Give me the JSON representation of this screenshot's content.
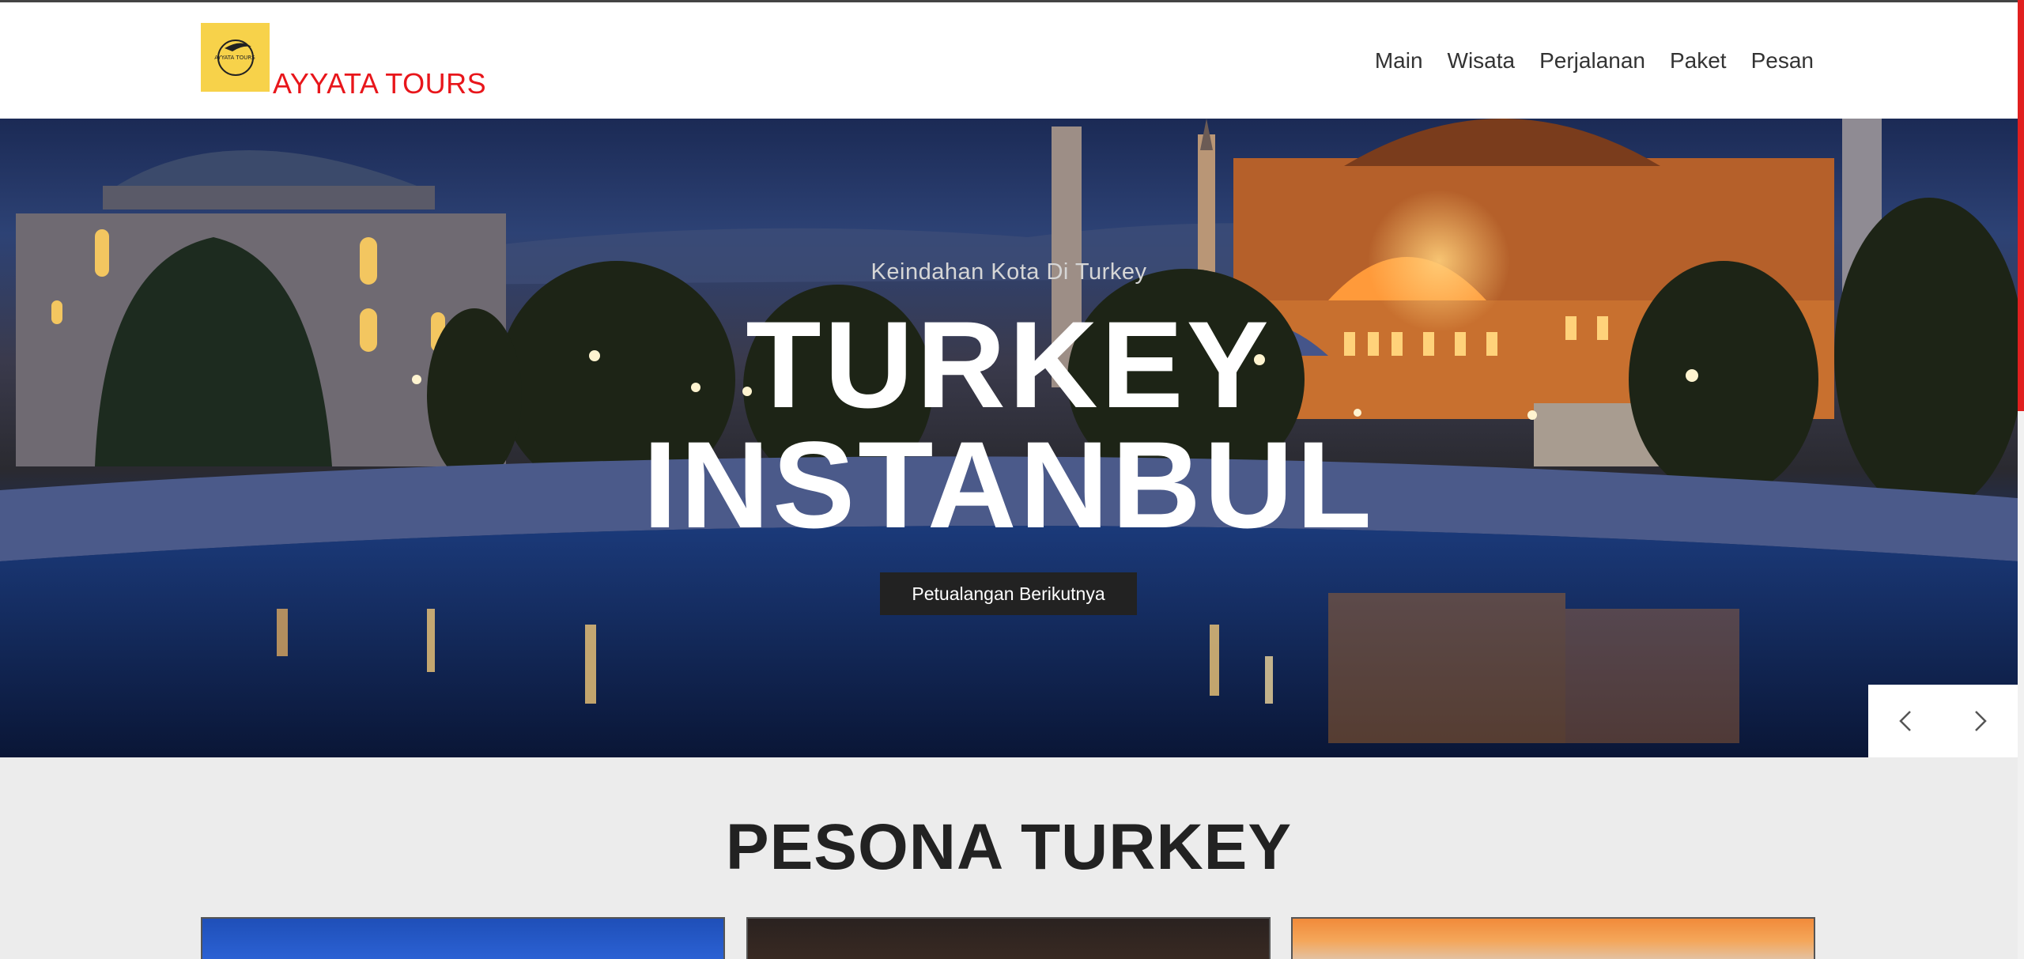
{
  "brand": {
    "name": "AYYATA TOURS",
    "logo_text": "AYYATA TOURS"
  },
  "nav": {
    "items": [
      "Main",
      "Wisata",
      "Perjalanan",
      "Paket",
      "Pesan"
    ]
  },
  "hero": {
    "subtitle": "Keindahan Kota Di Turkey",
    "title_line1": "TURKEY",
    "title_line2": "INSTANBUL",
    "button_label": "Petualangan Berikutnya",
    "prev_icon": "chevron-left-icon",
    "next_icon": "chevron-right-icon"
  },
  "section": {
    "title": "PESONA TURKEY"
  },
  "colors": {
    "brand": "#e8161b",
    "logo_bg": "#f7d24a",
    "button_bg": "#222222"
  }
}
